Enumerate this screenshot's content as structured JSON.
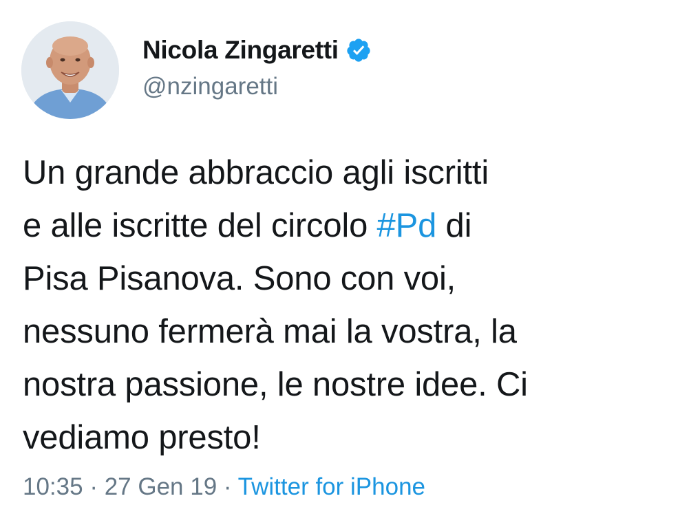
{
  "tweet": {
    "author": {
      "display_name": "Nicola Zingaretti",
      "handle": "@nzingaretti",
      "verified": true,
      "avatar_icon": "profile-photo"
    },
    "text_lines": [
      {
        "before": "Un grande abbraccio agli iscritti",
        "hashtag": "",
        "after": ""
      },
      {
        "before": "e alle iscritte del circolo ",
        "hashtag": "#Pd",
        "after": " di"
      },
      {
        "before": "Pisa Pisanova. Sono con voi,",
        "hashtag": "",
        "after": ""
      },
      {
        "before": "nessuno fermerà mai la vostra, la",
        "hashtag": "",
        "after": ""
      },
      {
        "before": "nostra passione, le nostre idee. Ci",
        "hashtag": "",
        "after": ""
      },
      {
        "before": "vediamo presto!",
        "hashtag": "",
        "after": ""
      }
    ],
    "meta": {
      "time": "10:35",
      "separator": " · ",
      "date": "27 Gen 19",
      "source": "Twitter for iPhone"
    }
  },
  "colors": {
    "link": "#1b95e0",
    "secondary_text": "#657786",
    "primary_text": "#14171a",
    "verified_badge": "#1da1f2"
  }
}
